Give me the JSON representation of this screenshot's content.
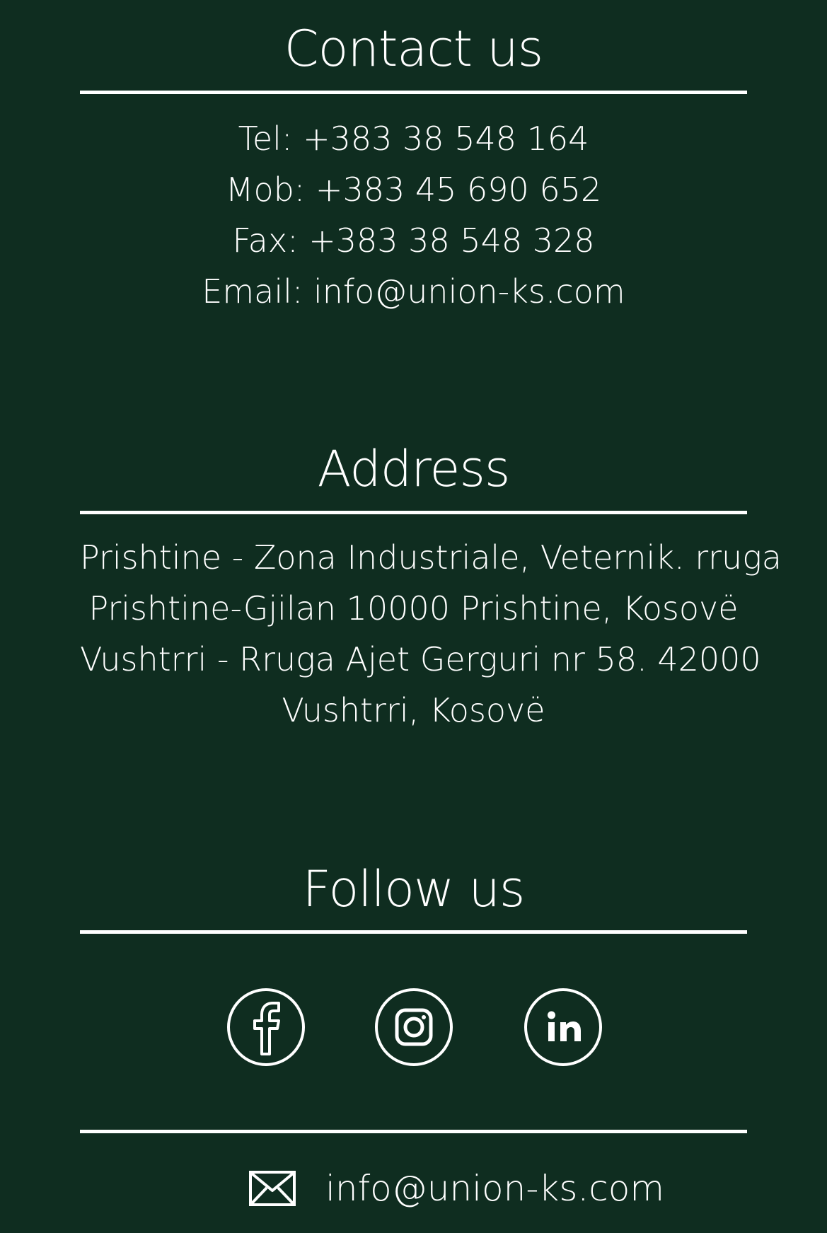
{
  "contact": {
    "title": "Contact us",
    "tel_label": "Tel:",
    "tel_value": "+383 38 548 164",
    "mob_label": "Mob:",
    "mob_value": "+383 45 690 652",
    "fax_label": "Fax:",
    "fax_value": "+383 38 548 328",
    "email_label": "Email:",
    "email_value": "info@union-ks.com"
  },
  "address": {
    "title": "Address",
    "lines": [
      "Prishtine - Zona Industriale, Veternik. rruga",
      "Prishtine-Gjilan 10000 Prishtine, Kosovë",
      "Vushtrri - Rruga Ajet Gerguri nr 58. 42000",
      "Vushtrri, Kosovë"
    ]
  },
  "follow": {
    "title": "Follow us",
    "icons": {
      "facebook": "facebook-icon",
      "instagram": "instagram-icon",
      "linkedin": "linkedin-icon"
    }
  },
  "footer": {
    "email": "info@union-ks.com",
    "icon": "envelope-icon"
  },
  "colors": {
    "background": "#0f2d20",
    "foreground": "#ffffff"
  }
}
